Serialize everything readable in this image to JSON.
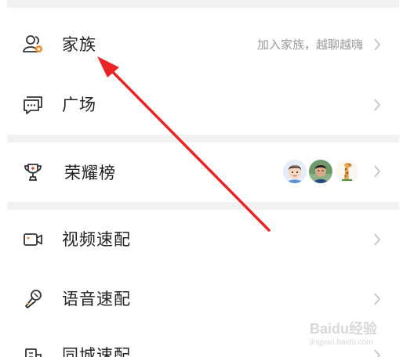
{
  "menu": {
    "family": {
      "label": "家族",
      "hint": "加入家族，越聊越嗨",
      "icon": "family-user-icon"
    },
    "square": {
      "label": "广场",
      "icon": "chat-bubble-icon"
    },
    "ranking": {
      "label": "荣耀榜",
      "icon": "trophy-icon",
      "avatars": [
        "cartoon-boy-avatar",
        "photo-boy-avatar",
        "giraffe-avatar"
      ]
    },
    "video_match": {
      "label": "视频速配",
      "icon": "video-camera-icon"
    },
    "voice_match": {
      "label": "语音速配",
      "icon": "microphone-icon"
    },
    "city_match": {
      "label": "同城速配",
      "icon": "city-icon"
    }
  },
  "watermark": {
    "brand": "Baidu经验",
    "url": "jingyan.baidu.com"
  },
  "colors": {
    "accent": "#f2882a",
    "arrow": "#e82424",
    "divider": "#f1f1f1"
  }
}
